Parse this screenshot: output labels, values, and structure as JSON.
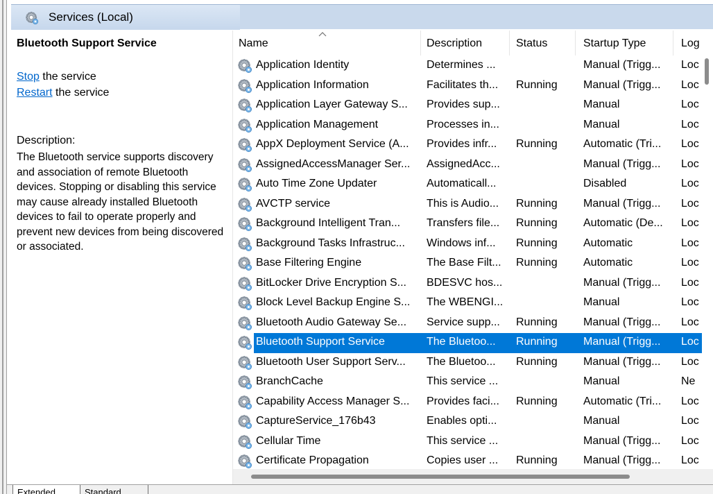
{
  "header": {
    "title": "Services (Local)",
    "icon": "gear-icon"
  },
  "left_pane": {
    "service_name": "Bluetooth Support Service",
    "stop_link": "Stop",
    "stop_rest": " the service",
    "restart_link": "Restart",
    "restart_rest": " the service",
    "description_label": "Description:",
    "description": "The Bluetooth service supports discovery and association of remote Bluetooth devices.  Stopping or disabling this service may cause already installed Bluetooth devices to fail to operate properly and prevent new devices from being discovered or associated."
  },
  "columns": [
    "Name",
    "Description",
    "Status",
    "Startup Type",
    "Log"
  ],
  "rows": [
    {
      "name": "Application Identity",
      "description": "Determines ...",
      "status": "",
      "startup": "Manual (Trigg...",
      "log": "Loc"
    },
    {
      "name": "Application Information",
      "description": "Facilitates th...",
      "status": "Running",
      "startup": "Manual (Trigg...",
      "log": "Loc"
    },
    {
      "name": "Application Layer Gateway S...",
      "description": "Provides sup...",
      "status": "",
      "startup": "Manual",
      "log": "Loc"
    },
    {
      "name": "Application Management",
      "description": "Processes in...",
      "status": "",
      "startup": "Manual",
      "log": "Loc"
    },
    {
      "name": "AppX Deployment Service (A...",
      "description": "Provides infr...",
      "status": "Running",
      "startup": "Automatic (Tri...",
      "log": "Loc"
    },
    {
      "name": "AssignedAccessManager Ser...",
      "description": "AssignedAcc...",
      "status": "",
      "startup": "Manual (Trigg...",
      "log": "Loc"
    },
    {
      "name": "Auto Time Zone Updater",
      "description": "Automaticall...",
      "status": "",
      "startup": "Disabled",
      "log": "Loc"
    },
    {
      "name": "AVCTP service",
      "description": "This is Audio...",
      "status": "Running",
      "startup": "Manual (Trigg...",
      "log": "Loc"
    },
    {
      "name": "Background Intelligent Tran...",
      "description": "Transfers file...",
      "status": "Running",
      "startup": "Automatic (De...",
      "log": "Loc"
    },
    {
      "name": "Background Tasks Infrastruc...",
      "description": "Windows inf...",
      "status": "Running",
      "startup": "Automatic",
      "log": "Loc"
    },
    {
      "name": "Base Filtering Engine",
      "description": "The Base Filt...",
      "status": "Running",
      "startup": "Automatic",
      "log": "Loc"
    },
    {
      "name": "BitLocker Drive Encryption S...",
      "description": "BDESVC hos...",
      "status": "",
      "startup": "Manual (Trigg...",
      "log": "Loc"
    },
    {
      "name": "Block Level Backup Engine S...",
      "description": "The WBENGI...",
      "status": "",
      "startup": "Manual",
      "log": "Loc"
    },
    {
      "name": "Bluetooth Audio Gateway Se...",
      "description": "Service supp...",
      "status": "Running",
      "startup": "Manual (Trigg...",
      "log": "Loc"
    },
    {
      "name": "Bluetooth Support Service",
      "description": "The Bluetoo...",
      "status": "Running",
      "startup": "Manual (Trigg...",
      "log": "Loc",
      "selected": true
    },
    {
      "name": "Bluetooth User Support Serv...",
      "description": "The Bluetoo...",
      "status": "Running",
      "startup": "Manual (Trigg...",
      "log": "Loc"
    },
    {
      "name": "BranchCache",
      "description": "This service ...",
      "status": "",
      "startup": "Manual",
      "log": "Ne"
    },
    {
      "name": "Capability Access Manager S...",
      "description": "Provides faci...",
      "status": "Running",
      "startup": "Automatic (Tri...",
      "log": "Loc"
    },
    {
      "name": "CaptureService_176b43",
      "description": "Enables opti...",
      "status": "",
      "startup": "Manual",
      "log": "Loc"
    },
    {
      "name": "Cellular Time",
      "description": "This service ...",
      "status": "",
      "startup": "Manual (Trigg...",
      "log": "Loc"
    },
    {
      "name": "Certificate Propagation",
      "description": "Copies user ...",
      "status": "Running",
      "startup": "Manual (Trigg...",
      "log": "Loc"
    }
  ],
  "bottom_tabs": [
    "Extended",
    "Standard"
  ],
  "colors": {
    "selection": "#0078d7",
    "link": "#0066cc",
    "header_bg": "#c9d9ec"
  }
}
